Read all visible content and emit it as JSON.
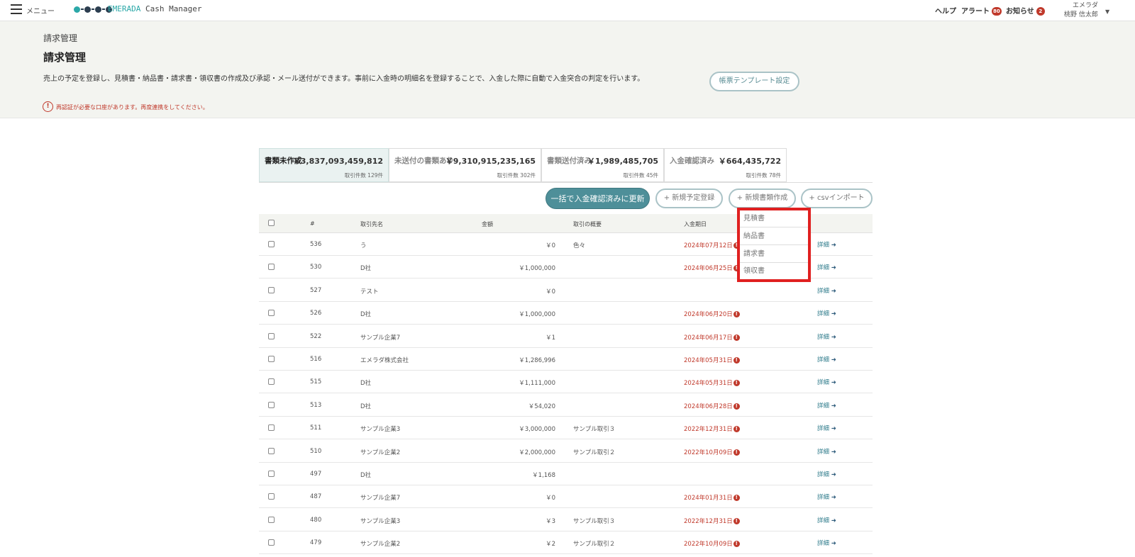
{
  "topbar": {
    "menu_label": "メニュー",
    "brand_prefix": "EMERADA",
    "brand_suffix": "Cash Manager",
    "help": "ヘルプ",
    "alert_label": "アラート",
    "alert_count": "80",
    "notice_label": "お知らせ",
    "notice_count": "2",
    "user_org": "エメラダ",
    "user_name": "桃野 信太郎",
    "logo_colors": [
      "#2ba8a8",
      "#2c3e50"
    ]
  },
  "header": {
    "breadcrumb": "請求管理",
    "title": "請求管理",
    "description": "売上の予定を登録し、見積書・納品書・請求書・領収書の作成及び承認・メール送付ができます。事前に入金時の明細名を登録することで、入金した際に自動で入金突合の判定を行います。",
    "template_button": "帳票テンプレート設定",
    "warning_icon": "!",
    "warning": "再認証が必要な口座があります。再度連携をしてください。"
  },
  "summary_tabs": [
    {
      "label": "書類未作成",
      "amount": "￥3,837,093,459,812",
      "count": "取引件数 129件",
      "active": true
    },
    {
      "label": "未送付の書類あり",
      "amount": "￥9,310,915,235,165",
      "count": "取引件数 302件",
      "active": false
    },
    {
      "label": "書類送付済み",
      "amount": "￥1,989,485,705",
      "count": "取引件数 45件",
      "active": false
    },
    {
      "label": "入金確認済み",
      "amount": "￥664,435,722",
      "count": "取引件数 78件",
      "active": false
    }
  ],
  "actions": {
    "bulk_update": "一括で入金確認済みに更新",
    "new_schedule": "+ 新規予定登録",
    "new_document": "+ 新規書類作成",
    "csv_import": "+ csvインポート"
  },
  "dropdown": {
    "items": [
      "見積書",
      "納品書",
      "請求書",
      "領収書"
    ]
  },
  "table": {
    "headers": {
      "id": "#",
      "client": "取引先名",
      "amount": "金額",
      "summary": "取引の概要",
      "due": "入金期日"
    },
    "detail_label": "詳細",
    "detail_arrow": "➜",
    "due_mark": "!",
    "rows": [
      {
        "id": "536",
        "client": "う",
        "amount": "￥0",
        "summary": "色々",
        "due": "2024年07月12日"
      },
      {
        "id": "530",
        "client": "D社",
        "amount": "￥1,000,000",
        "summary": "",
        "due": "2024年06月25日"
      },
      {
        "id": "527",
        "client": "テスト",
        "amount": "￥0",
        "summary": "",
        "due": ""
      },
      {
        "id": "526",
        "client": "D社",
        "amount": "￥1,000,000",
        "summary": "",
        "due": "2024年06月20日"
      },
      {
        "id": "522",
        "client": "サンプル企業7",
        "amount": "￥1",
        "summary": "",
        "due": "2024年06月17日"
      },
      {
        "id": "516",
        "client": "エメラダ株式会社",
        "amount": "￥1,286,996",
        "summary": "",
        "due": "2024年05月31日"
      },
      {
        "id": "515",
        "client": "D社",
        "amount": "￥1,111,000",
        "summary": "",
        "due": "2024年05月31日"
      },
      {
        "id": "513",
        "client": "D社",
        "amount": "￥54,020",
        "summary": "",
        "due": "2024年06月28日"
      },
      {
        "id": "511",
        "client": "サンプル企業3",
        "amount": "￥3,000,000",
        "summary": "サンプル取引３",
        "due": "2022年12月31日"
      },
      {
        "id": "510",
        "client": "サンプル企業2",
        "amount": "￥2,000,000",
        "summary": "サンプル取引２",
        "due": "2022年10月09日"
      },
      {
        "id": "497",
        "client": "D社",
        "amount": "￥1,168",
        "summary": "",
        "due": ""
      },
      {
        "id": "487",
        "client": "サンプル企業7",
        "amount": "￥0",
        "summary": "",
        "due": "2024年01月31日"
      },
      {
        "id": "480",
        "client": "サンプル企業3",
        "amount": "￥3",
        "summary": "サンプル取引３",
        "due": "2022年12月31日"
      },
      {
        "id": "479",
        "client": "サンプル企業2",
        "amount": "￥2",
        "summary": "サンプル取引２",
        "due": "2022年10月09日"
      }
    ]
  }
}
